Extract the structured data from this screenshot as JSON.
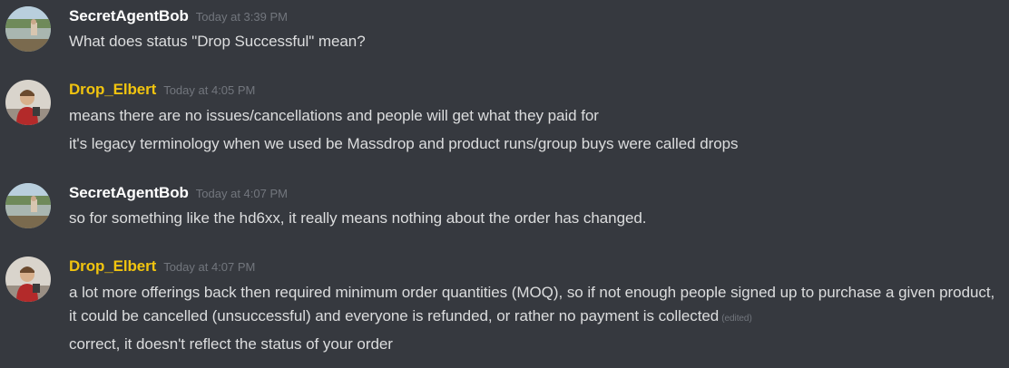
{
  "messages": [
    {
      "author": "SecretAgentBob",
      "timestamp": "Today at 3:39 PM",
      "avatar_icon": "landscape-photo-avatar",
      "lines": [
        "What does status \"Drop Successful\" mean?"
      ]
    },
    {
      "author": "Drop_Elbert",
      "author_color": "#f1c40f",
      "timestamp": "Today at 4:05 PM",
      "avatar_icon": "person-photo-avatar",
      "lines": [
        "means there are no issues/cancellations and people will get what they paid for",
        "it's legacy terminology when we used be Massdrop and product runs/group buys were called drops"
      ]
    },
    {
      "author": "SecretAgentBob",
      "timestamp": "Today at 4:07 PM",
      "avatar_icon": "landscape-photo-avatar",
      "lines": [
        "so for something like the hd6xx, it really means nothing about the order has changed."
      ]
    },
    {
      "author": "Drop_Elbert",
      "author_color": "#f1c40f",
      "timestamp": "Today at 4:07 PM",
      "avatar_icon": "person-photo-avatar",
      "lines": [
        "a lot more offerings back then required minimum order quantities (MOQ), so if not enough people signed up to purchase a given product, it could be cancelled (unsuccessful) and everyone is refunded, or rather no payment is collected",
        "correct, it doesn't reflect the status of your order"
      ],
      "edited_label": "(edited)"
    }
  ],
  "colors": {
    "background": "#36393f",
    "message_text": "#dcddde",
    "timestamp": "#72767d",
    "author_default": "#ffffff",
    "author_highlight": "#f1c40f"
  }
}
